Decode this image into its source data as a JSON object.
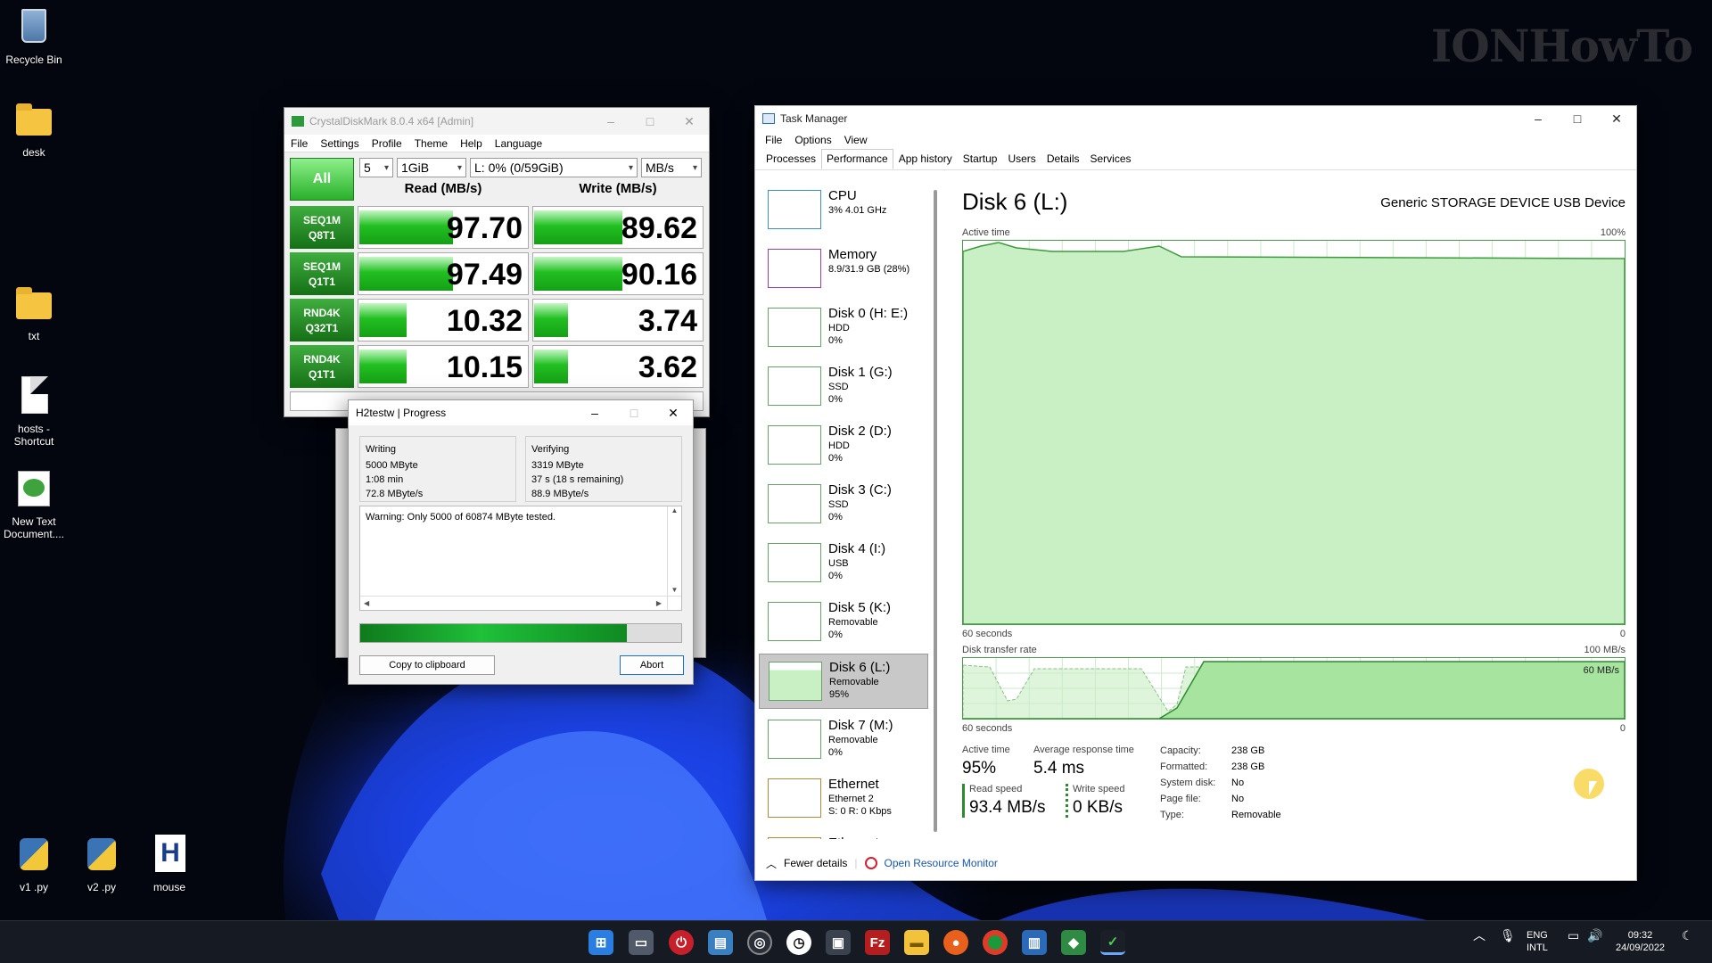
{
  "watermark": "IONHowTo",
  "desktop_icons": [
    {
      "label": "Recycle Bin"
    },
    {
      "label": "desk"
    },
    {
      "label": "txt"
    },
    {
      "label": "hosts - Shortcut"
    },
    {
      "label": "New Text Document...."
    },
    {
      "label": "v1 .py"
    },
    {
      "label": "v2 .py"
    },
    {
      "label": "mouse"
    }
  ],
  "cdm": {
    "title": "CrystalDiskMark 8.0.4 x64 [Admin]",
    "menu": [
      "File",
      "Settings",
      "Profile",
      "Theme",
      "Help",
      "Language"
    ],
    "all_label": "All",
    "count": "5",
    "size": "1GiB",
    "drive": "L: 0% (0/59GiB)",
    "unit": "MB/s",
    "read_header": "Read (MB/s)",
    "write_header": "Write (MB/s)",
    "rows": [
      {
        "l1": "SEQ1M",
        "l2": "Q8T1",
        "read": "97.70",
        "write": "89.62",
        "read_frac": 0.55,
        "write_frac": 0.52
      },
      {
        "l1": "SEQ1M",
        "l2": "Q1T1",
        "read": "97.49",
        "write": "90.16",
        "read_frac": 0.55,
        "write_frac": 0.52
      },
      {
        "l1": "RND4K",
        "l2": "Q32T1",
        "read": "10.32",
        "write": "3.74",
        "read_frac": 0.28,
        "write_frac": 0.2
      },
      {
        "l1": "RND4K",
        "l2": "Q1T1",
        "read": "10.15",
        "write": "3.62",
        "read_frac": 0.28,
        "write_frac": 0.2
      }
    ]
  },
  "h2": {
    "title": "H2testw | Progress",
    "writing_label": "Writing",
    "writing_size": "5000 MByte",
    "writing_time": "1:08 min",
    "writing_speed": "72.8 MByte/s",
    "verifying_label": "Verifying",
    "verifying_size": "3319 MByte",
    "verifying_time": "37 s (18 s remaining)",
    "verifying_speed": "88.9 MByte/s",
    "log": "Warning: Only 5000 of 60874 MByte tested.",
    "progress": 0.83,
    "copy_label": "Copy to clipboard",
    "abort_label": "Abort"
  },
  "tm": {
    "title": "Task Manager",
    "menu": [
      "File",
      "Options",
      "View"
    ],
    "tabs": [
      "Processes",
      "Performance",
      "App history",
      "Startup",
      "Users",
      "Details",
      "Services"
    ],
    "active_tab": "Performance",
    "sidebar": [
      {
        "name": "CPU",
        "sub1": "3% 4.01 GHz",
        "sub2": "",
        "kind": "cpu"
      },
      {
        "name": "Memory",
        "sub1": "8.9/31.9 GB (28%)",
        "sub2": "",
        "kind": "mem"
      },
      {
        "name": "Disk 0 (H: E:)",
        "sub1": "HDD",
        "sub2": "0%",
        "kind": "disk"
      },
      {
        "name": "Disk 1 (G:)",
        "sub1": "SSD",
        "sub2": "0%",
        "kind": "disk"
      },
      {
        "name": "Disk 2 (D:)",
        "sub1": "HDD",
        "sub2": "0%",
        "kind": "disk"
      },
      {
        "name": "Disk 3 (C:)",
        "sub1": "SSD",
        "sub2": "0%",
        "kind": "disk"
      },
      {
        "name": "Disk 4 (I:)",
        "sub1": "USB",
        "sub2": "0%",
        "kind": "disk"
      },
      {
        "name": "Disk 5 (K:)",
        "sub1": "Removable",
        "sub2": "0%",
        "kind": "disk"
      },
      {
        "name": "Disk 6 (L:)",
        "sub1": "Removable",
        "sub2": "95%",
        "kind": "disk-sel"
      },
      {
        "name": "Disk 7 (M:)",
        "sub1": "Removable",
        "sub2": "0%",
        "kind": "disk"
      },
      {
        "name": "Ethernet",
        "sub1": "Ethernet 2",
        "sub2": "S: 0 R: 0 Kbps",
        "kind": "eth"
      },
      {
        "name": "Ethernet",
        "sub1": "",
        "sub2": "",
        "kind": "eth"
      }
    ],
    "disk_title": "Disk 6 (L:)",
    "device": "Generic STORAGE DEVICE USB Device",
    "active_time_label": "Active time",
    "pct_100": "100%",
    "sixty_seconds": "60 seconds",
    "zero": "0",
    "transfer_label": "Disk transfer rate",
    "transfer_max": "100 MB/s",
    "transfer_mark": "60 MB/s",
    "stats": {
      "active_label": "Active time",
      "active_value": "95%",
      "resp_label": "Average response time",
      "resp_value": "5.4 ms",
      "read_label": "Read speed",
      "read_value": "93.4 MB/s",
      "write_label": "Write speed",
      "write_value": "0 KB/s"
    },
    "props": [
      {
        "k": "Capacity:",
        "v": "238 GB"
      },
      {
        "k": "Formatted:",
        "v": "238 GB"
      },
      {
        "k": "System disk:",
        "v": "No"
      },
      {
        "k": "Page file:",
        "v": "No"
      },
      {
        "k": "Type:",
        "v": "Removable"
      }
    ],
    "fewer": "Fewer details",
    "resmon": "Open Resource Monitor"
  },
  "tray": {
    "lang1": "ENG",
    "lang2": "INTL",
    "time": "09:32",
    "date": "24/09/2022"
  },
  "colors": {
    "accent_green": "#22c022",
    "tm_graph": "#c9efc4",
    "taskbar": "#161a22"
  }
}
